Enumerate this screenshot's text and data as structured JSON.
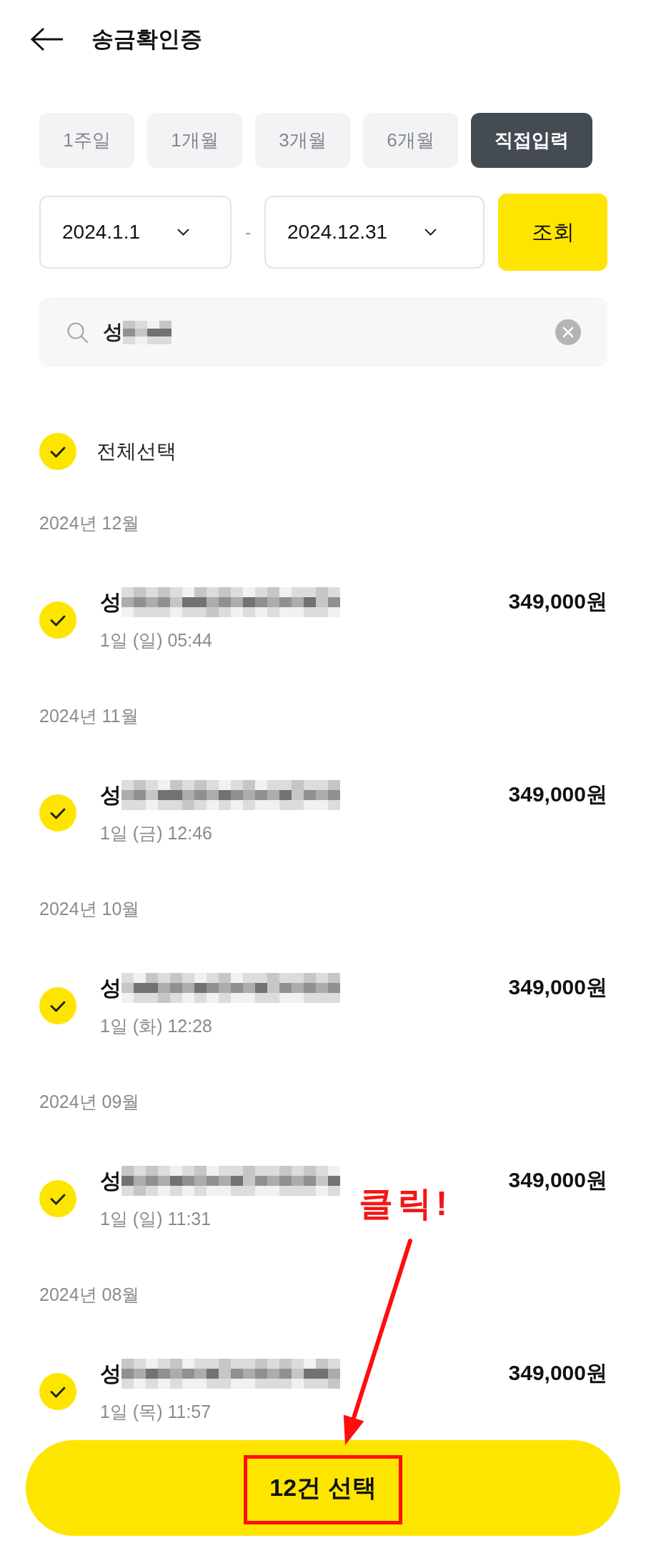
{
  "header": {
    "title": "송금확인증"
  },
  "period_tabs": [
    {
      "label": "1주일",
      "selected": false
    },
    {
      "label": "1개월",
      "selected": false
    },
    {
      "label": "3개월",
      "selected": false
    },
    {
      "label": "6개월",
      "selected": false
    },
    {
      "label": "직접입력",
      "selected": true
    }
  ],
  "date_range": {
    "start": "2024.1.1",
    "separator": "-",
    "end": "2024.12.31",
    "query_button": "조회"
  },
  "search": {
    "value": "성",
    "redacted": true
  },
  "select_all": {
    "label": "전체선택",
    "checked": true
  },
  "groups": [
    {
      "month": "2024년 12월",
      "items": [
        {
          "name": "성",
          "redacted": true,
          "time": "1일 (일) 05:44",
          "amount": "349,000원",
          "checked": true
        }
      ]
    },
    {
      "month": "2024년 11월",
      "items": [
        {
          "name": "성",
          "redacted": true,
          "time": "1일 (금) 12:46",
          "amount": "349,000원",
          "checked": true
        }
      ]
    },
    {
      "month": "2024년 10월",
      "items": [
        {
          "name": "성",
          "redacted": true,
          "time": "1일 (화) 12:28",
          "amount": "349,000원",
          "checked": true
        }
      ]
    },
    {
      "month": "2024년 09월",
      "items": [
        {
          "name": "성",
          "redacted": true,
          "time": "1일 (일) 11:31",
          "amount": "349,000원",
          "checked": true
        }
      ]
    },
    {
      "month": "2024년 08월",
      "items": [
        {
          "name": "성",
          "redacted": true,
          "time": "1일 (목) 11:57",
          "amount": "349,000원",
          "checked": true
        }
      ]
    }
  ],
  "bottom_button": {
    "label": "12건 선택",
    "highlighted": true
  },
  "annotation": {
    "text": "클릭!"
  }
}
